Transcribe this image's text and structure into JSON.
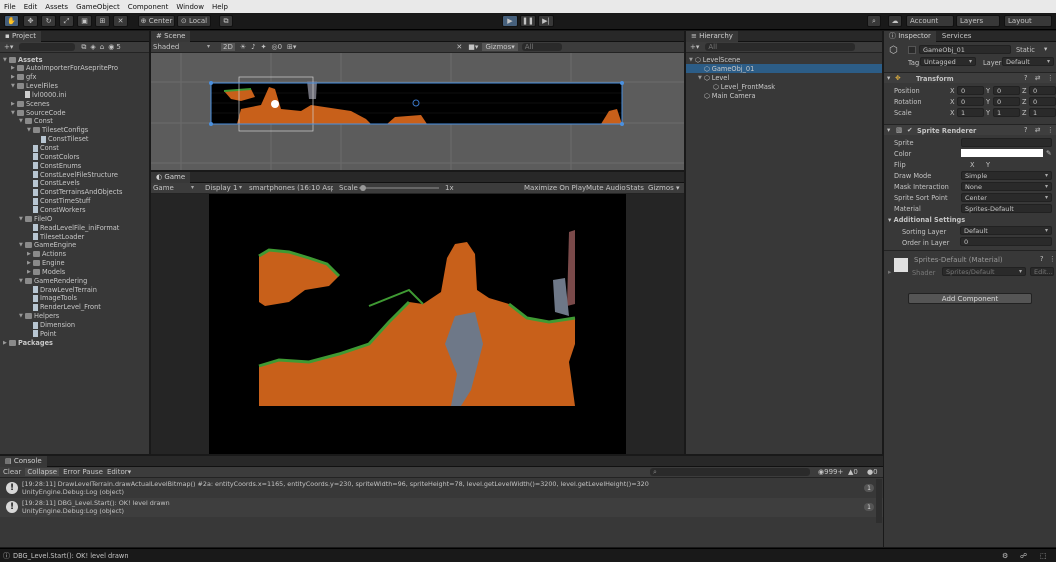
{
  "menu": [
    "File",
    "Edit",
    "Assets",
    "GameObject",
    "Component",
    "Window",
    "Help"
  ],
  "toolbar": {
    "tools": [
      "hand-tool-icon",
      "move-tool-icon",
      "rotate-tool-icon",
      "scale-tool-icon",
      "rect-tool-icon",
      "transform-tool-icon",
      "custom-tool-icon"
    ],
    "pivot": "Center",
    "space": "Local",
    "account": "Account",
    "layers": "Layers",
    "layout": "Layout"
  },
  "project": {
    "tab": "Project",
    "count": "5",
    "tree": [
      {
        "label": "Assets",
        "depth": 0,
        "type": "folder",
        "bold": true,
        "open": true
      },
      {
        "label": "AutoImporterForAsepritePro",
        "depth": 1,
        "type": "folder"
      },
      {
        "label": "gfx",
        "depth": 1,
        "type": "folder"
      },
      {
        "label": "LevelFiles",
        "depth": 1,
        "type": "folder",
        "open": true
      },
      {
        "label": "lvl0000.ini",
        "depth": 2,
        "type": "file"
      },
      {
        "label": "Scenes",
        "depth": 1,
        "type": "folder"
      },
      {
        "label": "SourceCode",
        "depth": 1,
        "type": "folder",
        "open": true
      },
      {
        "label": "Const",
        "depth": 2,
        "type": "folder",
        "open": true
      },
      {
        "label": "TilesetConfigs",
        "depth": 3,
        "type": "folder",
        "open": true
      },
      {
        "label": "ConstTileset",
        "depth": 4,
        "type": "script"
      },
      {
        "label": "Const",
        "depth": 3,
        "type": "script"
      },
      {
        "label": "ConstColors",
        "depth": 3,
        "type": "script"
      },
      {
        "label": "ConstEnums",
        "depth": 3,
        "type": "script"
      },
      {
        "label": "ConstLevelFileStructure",
        "depth": 3,
        "type": "script"
      },
      {
        "label": "ConstLevels",
        "depth": 3,
        "type": "script"
      },
      {
        "label": "ConstTerrainsAndObjects",
        "depth": 3,
        "type": "script"
      },
      {
        "label": "ConstTimeStuff",
        "depth": 3,
        "type": "script"
      },
      {
        "label": "ConstWorkers",
        "depth": 3,
        "type": "script"
      },
      {
        "label": "FileIO",
        "depth": 2,
        "type": "folder",
        "open": true
      },
      {
        "label": "ReadLevelFile_iniFormat",
        "depth": 3,
        "type": "script"
      },
      {
        "label": "TilesetLoader",
        "depth": 3,
        "type": "script"
      },
      {
        "label": "GameEngine",
        "depth": 2,
        "type": "folder",
        "open": true
      },
      {
        "label": "Actions",
        "depth": 3,
        "type": "folder"
      },
      {
        "label": "Engine",
        "depth": 3,
        "type": "folder"
      },
      {
        "label": "Models",
        "depth": 3,
        "type": "folder"
      },
      {
        "label": "GameRendering",
        "depth": 2,
        "type": "folder",
        "open": true
      },
      {
        "label": "DrawLevelTerrain",
        "depth": 3,
        "type": "script"
      },
      {
        "label": "ImageTools",
        "depth": 3,
        "type": "script"
      },
      {
        "label": "RenderLevel_Front",
        "depth": 3,
        "type": "script"
      },
      {
        "label": "Helpers",
        "depth": 2,
        "type": "folder",
        "open": true
      },
      {
        "label": "Dimension",
        "depth": 3,
        "type": "script"
      },
      {
        "label": "Point",
        "depth": 3,
        "type": "script"
      },
      {
        "label": "Packages",
        "depth": 0,
        "type": "folder",
        "bold": true
      }
    ]
  },
  "scene": {
    "tab": "Scene",
    "shading": "Shaded",
    "mode2d": "2D",
    "gizmos": "Gizmos",
    "search_placeholder": "All"
  },
  "game": {
    "tab": "Game",
    "view": "Game",
    "display": "Display 1",
    "aspect": "smartphones (16:10 Aspe",
    "scale_label": "Scale",
    "scale_value": "1x",
    "maximize": "Maximize On Play",
    "mute": "Mute Audio",
    "stats": "Stats",
    "gizmos": "Gizmos"
  },
  "hierarchy": {
    "tab": "Hierarchy",
    "search_placeholder": "All",
    "items": [
      {
        "label": "LevelScene",
        "depth": 0,
        "open": true
      },
      {
        "label": "GameObj_01",
        "depth": 1,
        "selected": true
      },
      {
        "label": "Level",
        "depth": 1,
        "open": true
      },
      {
        "label": "Level_FrontMask",
        "depth": 2
      },
      {
        "label": "Main Camera",
        "depth": 1
      }
    ]
  },
  "inspector": {
    "tabs": [
      "Inspector",
      "Services"
    ],
    "object_name": "GameObj_01",
    "static_label": "Static",
    "tag_label": "Tag",
    "tag_value": "Untagged",
    "layer_label": "Layer",
    "layer_value": "Default",
    "transform": {
      "title": "Transform",
      "rows": [
        {
          "label": "Position",
          "x": "0",
          "y": "0",
          "z": "0"
        },
        {
          "label": "Rotation",
          "x": "0",
          "y": "0",
          "z": "0"
        },
        {
          "label": "Scale",
          "x": "1",
          "y": "1",
          "z": "1"
        }
      ],
      "axis": [
        "X",
        "Y",
        "Z"
      ]
    },
    "sprite_renderer": {
      "title": "Sprite Renderer",
      "rows": [
        {
          "label": "Sprite",
          "value": ""
        },
        {
          "label": "Color",
          "value": ""
        },
        {
          "label": "Flip",
          "value": ""
        },
        {
          "label": "Draw Mode",
          "value": "Simple"
        },
        {
          "label": "Mask Interaction",
          "value": "None"
        },
        {
          "label": "Sprite Sort Point",
          "value": "Center"
        },
        {
          "label": "Material",
          "value": "Sprites-Default"
        }
      ],
      "flip_x": "X",
      "flip_y": "Y",
      "additional": "Additional Settings",
      "sorting_layer_label": "Sorting Layer",
      "sorting_layer_value": "Default",
      "order_label": "Order in Layer",
      "order_value": "0"
    },
    "material": {
      "name": "Sprites-Default (Material)",
      "shader_label": "Shader",
      "shader_value": "Sprites/Default",
      "edit": "Edit..."
    },
    "add_component": "Add Component"
  },
  "console": {
    "tab": "Console",
    "buttons": [
      "Clear",
      "Collapse",
      "Error Pause",
      "Editor"
    ],
    "counts": {
      "log": "999+",
      "warn": "0",
      "error": "0"
    },
    "entries": [
      {
        "line1": "[19:28:11] DrawLevelTerrain.drawActualLevelBitmap() #2a: entityCoords.x=1165, entityCoords.y=230, spriteWidth=96, spriteHeight=78, level.getLevelWidth()=3200, level.getLevelHeight()=320",
        "line2": "UnityEngine.Debug:Log (object)",
        "count": "1"
      },
      {
        "line1": "[19:28:11] DBG_Level.Start(): OK! level drawn",
        "line2": "UnityEngine.Debug:Log (object)",
        "count": "1"
      }
    ]
  },
  "statusbar": {
    "text": "DBG_Level.Start(): OK! level drawn"
  },
  "colors": {
    "accent": "#2c5d87",
    "terrain": "#c8601a",
    "grass": "#3f9a33"
  }
}
